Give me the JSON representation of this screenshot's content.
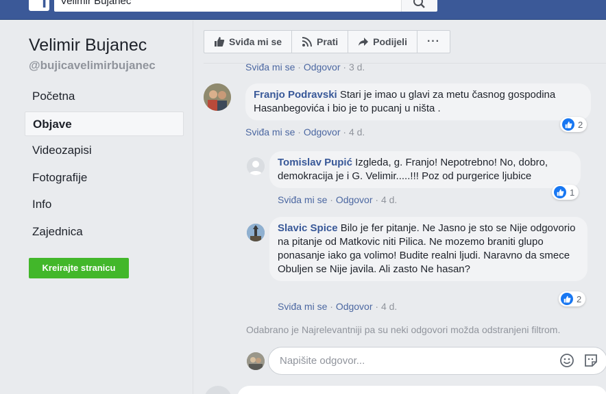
{
  "header": {
    "search_value": "Velimir Bujanec",
    "logo_letter": "f"
  },
  "sidebar": {
    "page_name": "Velimir Bujanec",
    "handle": "@bujicavelimirbujanec",
    "items": [
      {
        "label": "Početna",
        "active": false
      },
      {
        "label": "Objave",
        "active": true
      },
      {
        "label": "Videozapisi",
        "active": false
      },
      {
        "label": "Fotografije",
        "active": false
      },
      {
        "label": "Info",
        "active": false
      },
      {
        "label": "Zajednica",
        "active": false
      }
    ],
    "create_button": "Kreirajte stranicu"
  },
  "action_bar": {
    "like": "Sviđa mi se",
    "follow": "Prati",
    "share": "Podijeli",
    "more": "···"
  },
  "comments": [
    {
      "meta": {
        "like": "Sviđa mi se",
        "sep1": " · ",
        "reply": "Odgovor",
        "sep2": " · ",
        "time": "3 d."
      }
    },
    {
      "author": "Franjo Podravski",
      "text": " Stari je imao u glavi za metu časnog gospodina Hasanbegovića i bio je to pucanj u ništa .",
      "reactions": "2",
      "meta": {
        "like": "Sviđa mi se",
        "sep1": " · ",
        "reply": "Odgovor",
        "sep2": " · ",
        "time": "4 d."
      }
    },
    {
      "author": "Tomislav Pupić",
      "text": " Izgleda, g. Franjo! Nepotrebno! No, dobro, demokracija je i G. Velimir.....!!! Poz od purgerice ljubice",
      "reactions": "1",
      "meta": {
        "like": "Sviđa mi se",
        "sep1": " · ",
        "reply": "Odgovor",
        "sep2": " · ",
        "time": "4 d."
      }
    },
    {
      "author": "Slavic Spice",
      "text": " Bilo je fer pitanje. Ne Jasno je sto se Nije odgovorio na pitanje od Matkovic niti Pilica. Ne mozemo braniti glupo ponasanje iako ga volimo! Budite realni ljudi. Naravno da smece Obuljen se Nije javila. Ali zasto Ne hasan?",
      "reactions": "2",
      "meta": {
        "like": "Sviđa mi se",
        "sep1": " · ",
        "reply": "Odgovor",
        "sep2": " · ",
        "time": "4 d."
      }
    }
  ],
  "filter_note": "Odabrano je Najrelevantniji pa su neki odgovori možda odstranjeni filtrom.",
  "reply": {
    "placeholder": "Napišite odgovor..."
  },
  "colors": {
    "brand": "#3b5998",
    "link": "#385898",
    "green": "#42b72a",
    "like_blue": "#1877f2"
  }
}
